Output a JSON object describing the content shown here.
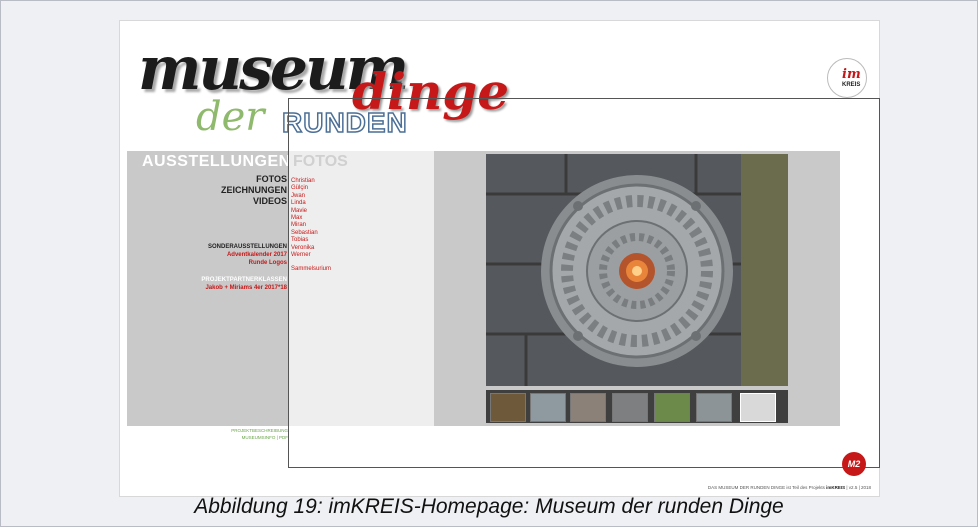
{
  "logo": {
    "museum": "museum",
    "dinge": "dinge",
    "der": "der",
    "runden": "RUNDEN",
    "badge_im": "im",
    "badge_kreis": "KREIS"
  },
  "section": {
    "ausstellungen": "AUSSTELLUNGEN",
    "fotos": "FOTOS"
  },
  "nav": {
    "main": [
      "FOTOS",
      "ZEICHNUNGEN",
      "VIDEOS"
    ],
    "sonder_heading": "SONDERAUSSTELLUNGEN",
    "sonder_links": [
      "Adventkalender 2017",
      "Runde Logos"
    ],
    "projekt_heading": "PROJEKTPARTNERKLASSEN",
    "projekt_links": [
      "Jakob + Miriams 4er 2017*18"
    ]
  },
  "names": [
    "Christian",
    "Gülçin",
    "Jwan",
    "Linda",
    "Mavie",
    "Max",
    "Miran",
    "Sebastian",
    "Tobias",
    "Veronika",
    "Werner"
  ],
  "sammelsurium": "Sammelsurium",
  "footer": {
    "projektbeschreibung": "PROJEKTBESCHREIBUNG",
    "museumsinfo": "MUSEUMSINFO | PDF",
    "credits_pre": "DAS MUSEUM DER RUNDEN DINGE ist Teil des Projekts",
    "credits_brand": "imKREIS",
    "credits_post": "| v2.5 | 2018"
  },
  "m2_badge": "M2",
  "caption": "Abbildung 19: imKREIS-Homepage: Museum der runden Dinge",
  "colors": {
    "accent_red": "#c61818",
    "green": "#8fb96c",
    "gray_panel": "#c9c9c9"
  }
}
